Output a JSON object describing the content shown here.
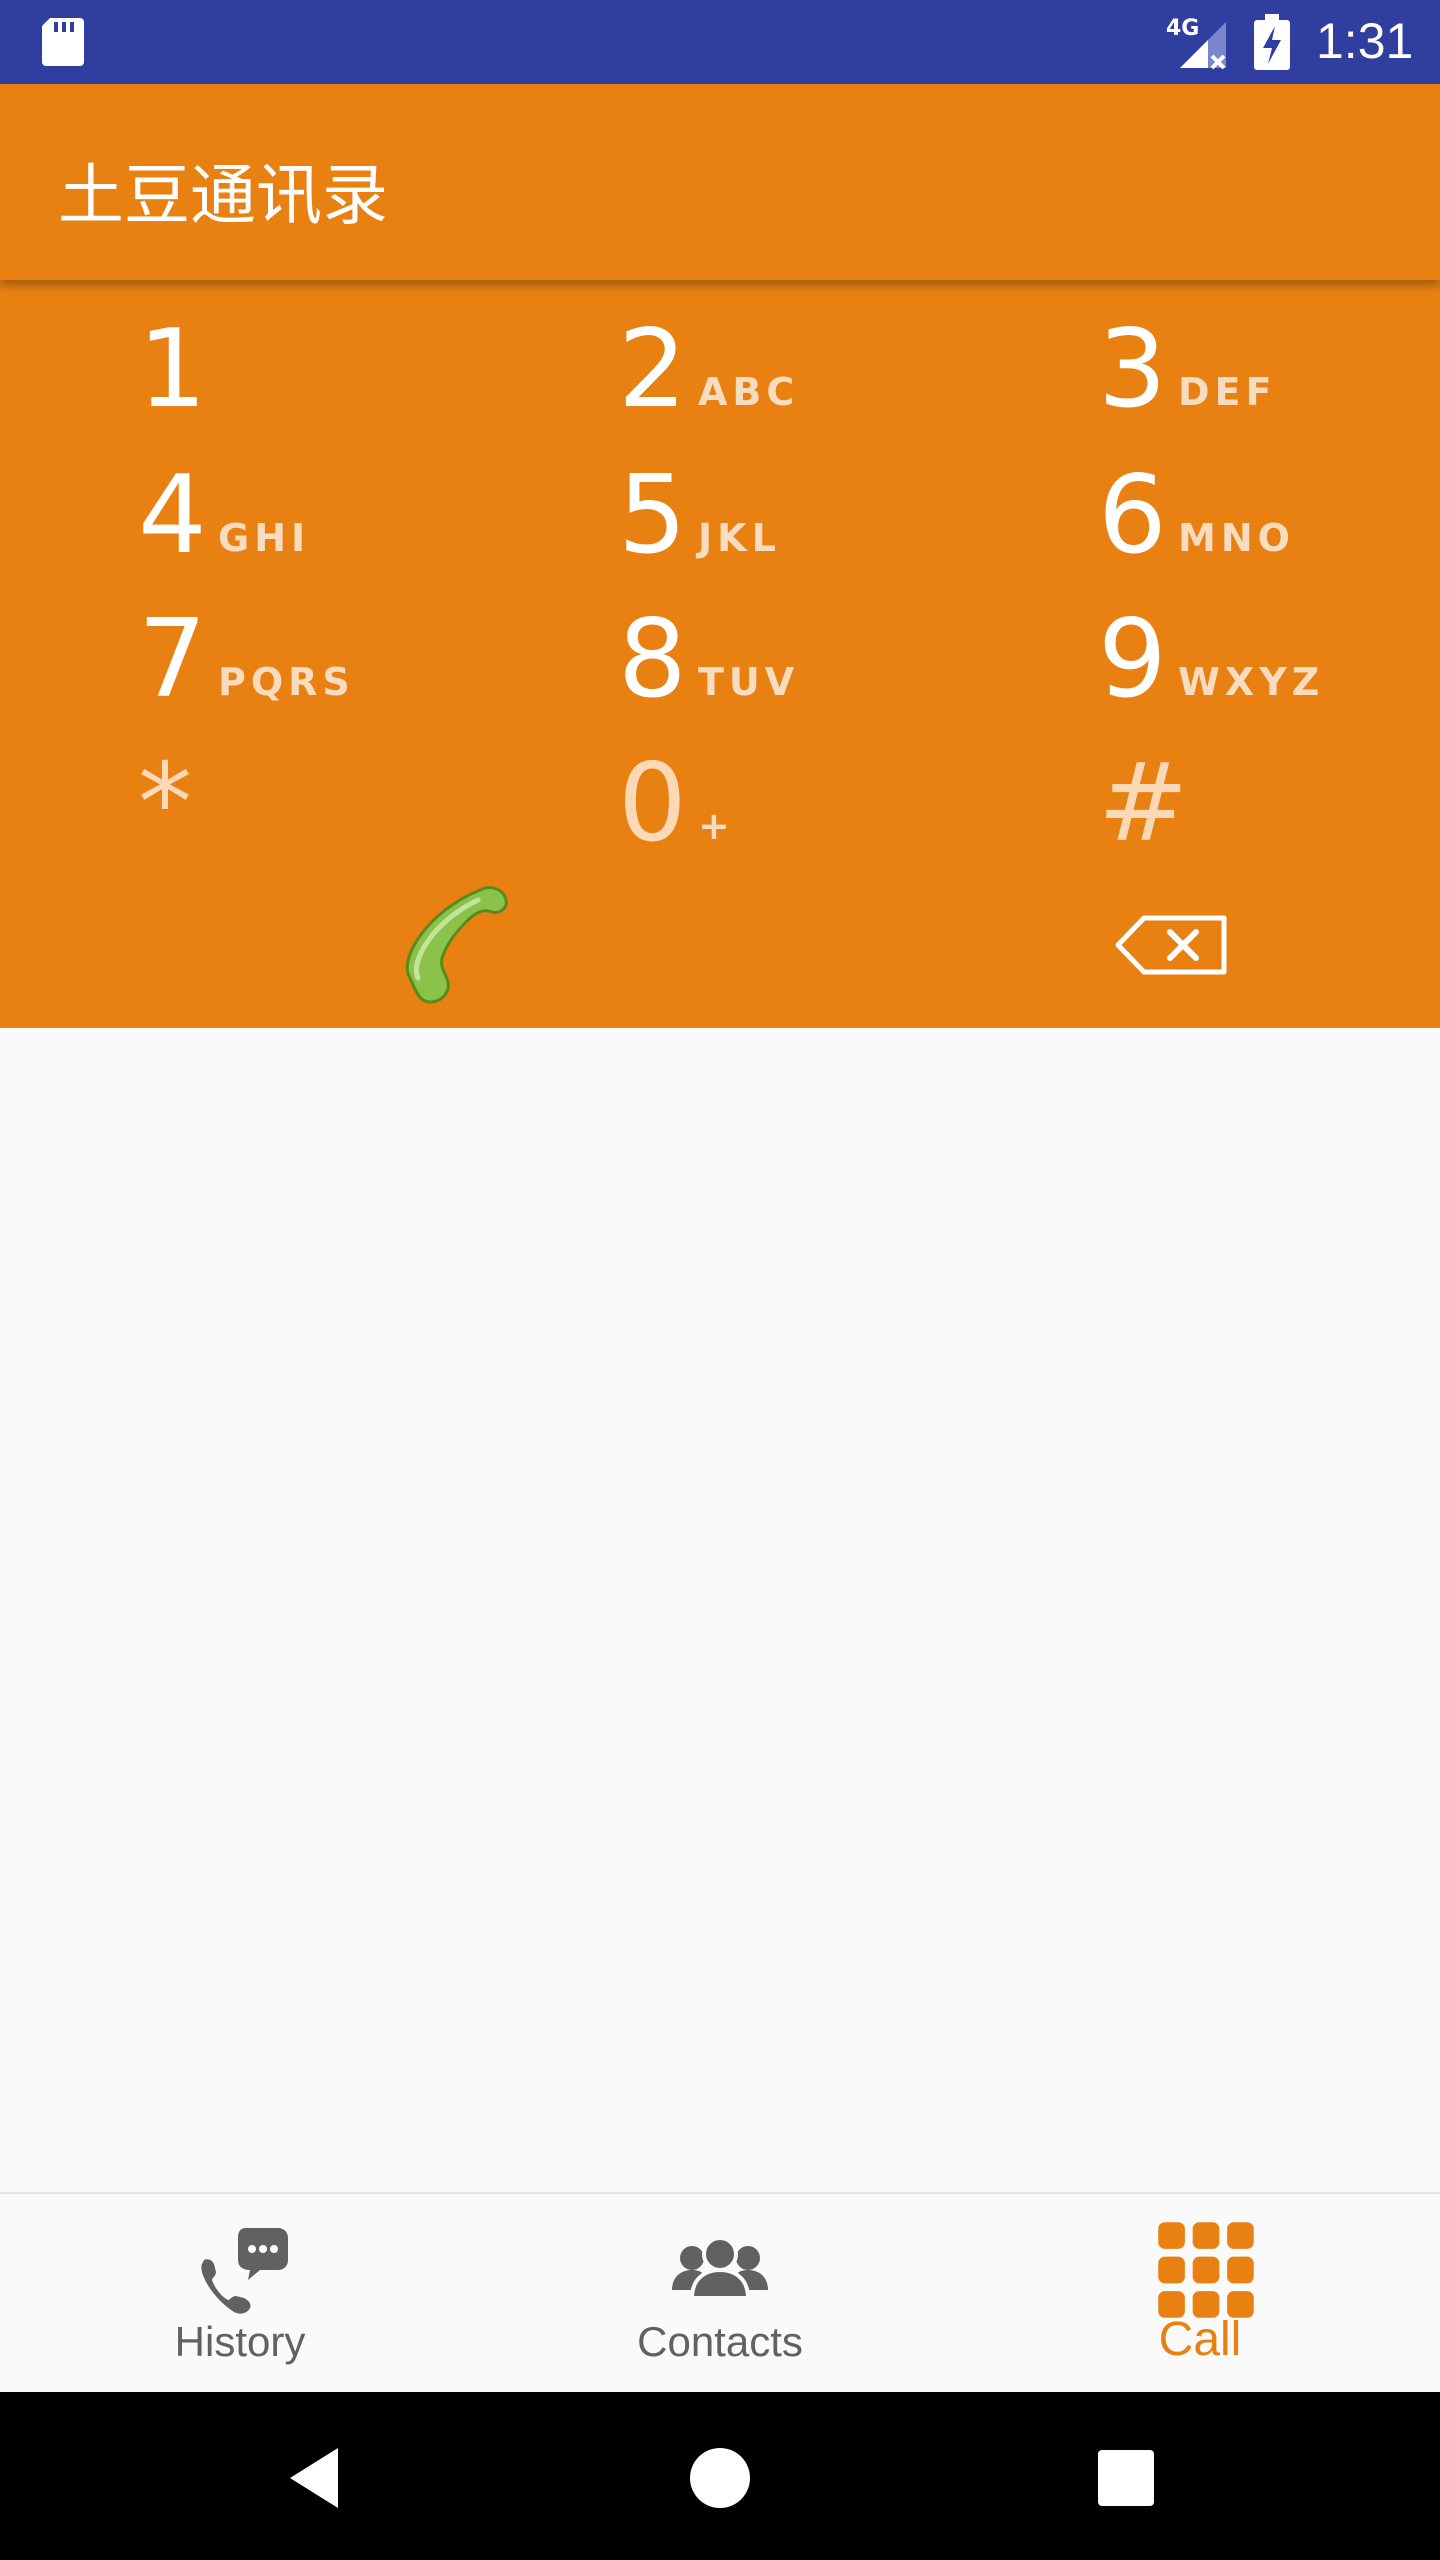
{
  "status_bar": {
    "network": "4G",
    "time": "1:31",
    "icons": [
      "sd-card-icon",
      "signal-icon",
      "battery-charging-icon"
    ]
  },
  "app_bar": {
    "title": "土豆通讯录"
  },
  "dialpad": {
    "keys": [
      {
        "digit": "1",
        "letters": ""
      },
      {
        "digit": "2",
        "letters": "ABC"
      },
      {
        "digit": "3",
        "letters": "DEF"
      },
      {
        "digit": "4",
        "letters": "GHI"
      },
      {
        "digit": "5",
        "letters": "JKL"
      },
      {
        "digit": "6",
        "letters": "MNO"
      },
      {
        "digit": "7",
        "letters": "PQRS"
      },
      {
        "digit": "8",
        "letters": "TUV"
      },
      {
        "digit": "9",
        "letters": "WXYZ"
      },
      {
        "digit": "*",
        "letters": ""
      },
      {
        "digit": "0",
        "letters": "+"
      },
      {
        "digit": "#",
        "letters": ""
      }
    ],
    "call_icon": "phone-icon",
    "backspace_icon": "backspace-icon"
  },
  "bottom_nav": {
    "items": [
      {
        "label": "History",
        "icon": "history-icon",
        "active": false
      },
      {
        "label": "Contacts",
        "icon": "contacts-icon",
        "active": false
      },
      {
        "label": "Call",
        "icon": "dialpad-icon",
        "active": true
      }
    ]
  },
  "colors": {
    "status_bar": "#303f9f",
    "primary": "#e98012",
    "call_green": "#8bc34a",
    "nav_inactive": "#616161"
  }
}
